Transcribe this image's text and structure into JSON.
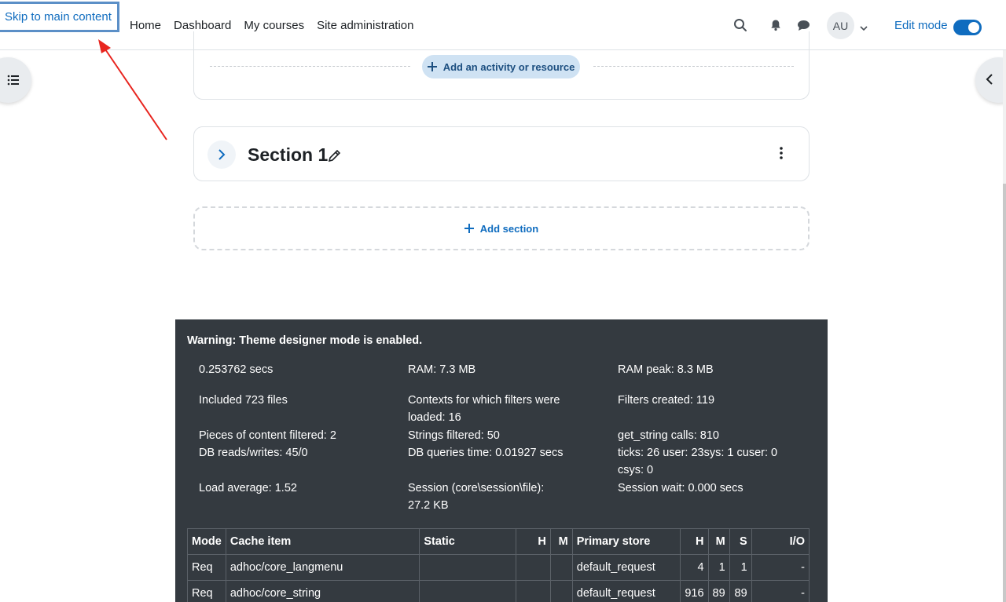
{
  "skip_link": "Skip to main content",
  "nav": {
    "links": [
      "Home",
      "Dashboard",
      "My courses",
      "Site administration"
    ],
    "avatar_initials": "AU",
    "edit_mode_label": "Edit mode",
    "edit_mode_on": true
  },
  "course": {
    "add_activity_label": "Add an activity or resource",
    "section_title": "Section 1",
    "add_section_label": "Add section"
  },
  "debug": {
    "warning": "Warning: Theme designer mode is enabled.",
    "rows": [
      [
        "0.253762 secs",
        "RAM: 7.3 MB",
        "RAM peak: 8.3 MB"
      ],
      [
        "Included 723 files",
        "Contexts for which filters were loaded: 16",
        "Filters created: 119"
      ],
      [
        "Pieces of content filtered: 2",
        "Strings filtered: 50",
        "get_string calls: 810"
      ],
      [
        "DB reads/writes: 45/0",
        "DB queries time: 0.01927 secs",
        "ticks: 26 user: 23sys: 1 cuser: 0 csys: 0"
      ],
      [
        "Load average: 1.52",
        "Session (core\\session\\file): 27.2 KB",
        "Session wait: 0.000 secs"
      ]
    ],
    "cache_table": {
      "headers": [
        "Mode",
        "Cache item",
        "Static",
        "H",
        "M",
        "Primary store",
        "H",
        "M",
        "S",
        "I/O"
      ],
      "rows": [
        [
          "Req",
          "adhoc/core_langmenu",
          "",
          "",
          "",
          "default_request",
          "4",
          "1",
          "1",
          "-"
        ],
        [
          "Req",
          "adhoc/core_string",
          "",
          "",
          "",
          "default_request",
          "916",
          "89",
          "89",
          "-"
        ]
      ]
    }
  },
  "colors": {
    "accent": "#0f6cbf",
    "debug_bg": "#343a40",
    "annotation_arrow": "#e8251f"
  }
}
